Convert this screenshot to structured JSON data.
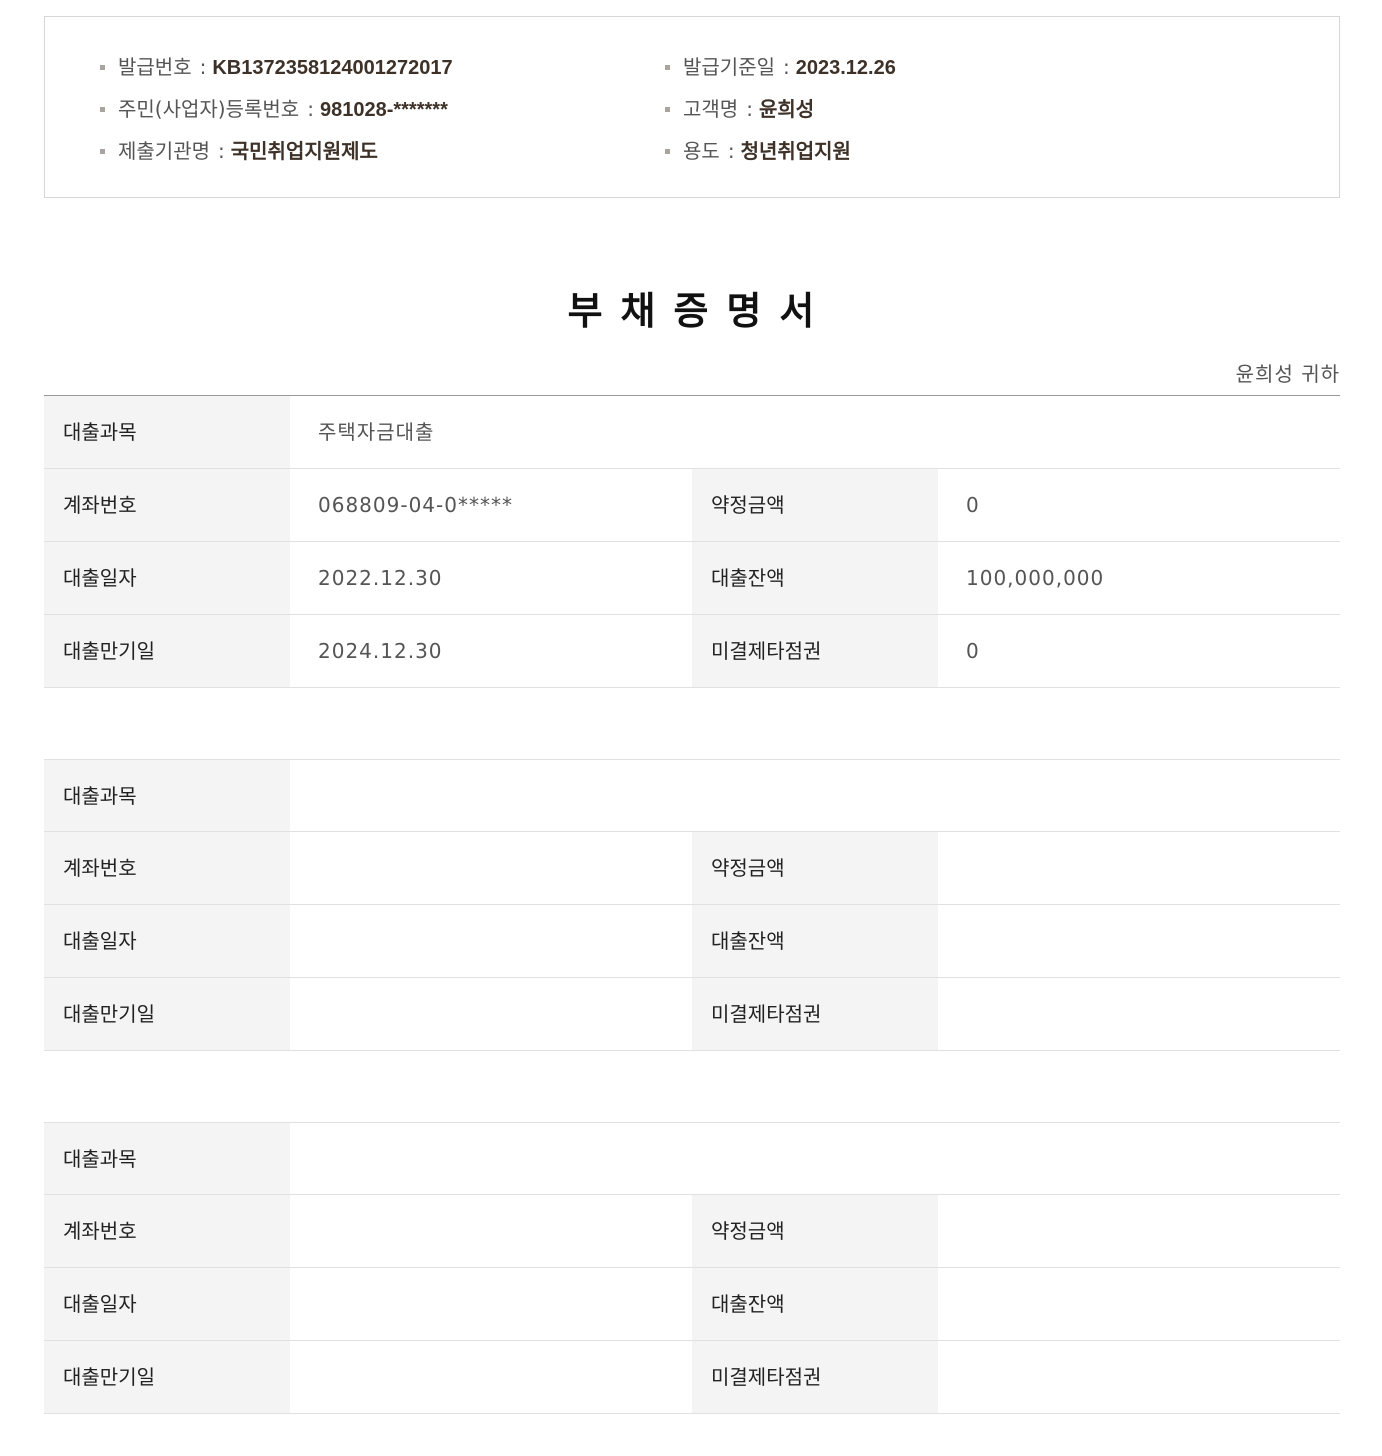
{
  "info": {
    "issue_no": {
      "label": "발급번호",
      "value": "KB137235812400127​2017"
    },
    "issue_date": {
      "label": "발급기준일",
      "value": "2023.12.26"
    },
    "reg_no": {
      "label": "주민(사업자)등록번호",
      "value": "981028-*******"
    },
    "customer": {
      "label": "고객명",
      "value": "윤희성"
    },
    "submit_org": {
      "label": "제출기관명",
      "value": "국민취업지원제도"
    },
    "purpose": {
      "label": "용도",
      "value": "청년취업지원"
    },
    "separator": ":"
  },
  "title": "부채증명서",
  "recipient": "윤희성 귀하",
  "labels": {
    "loan_type": "대출과목",
    "account_no": "계좌번호",
    "agreed_amount": "약정금액",
    "loan_date": "대출일자",
    "loan_balance": "대출잔액",
    "maturity_date": "대출만기일",
    "unsettled_bills": "미결제타점권"
  },
  "loans": [
    {
      "loan_type": "주택자금대출",
      "account_no": "068809-04-0*****",
      "agreed_amount": "0",
      "loan_date": "2022.12.30",
      "loan_balance": "100,000,000",
      "maturity_date": "2024.12.30",
      "unsettled_bills": "0"
    },
    {
      "loan_type": "",
      "account_no": "",
      "agreed_amount": "",
      "loan_date": "",
      "loan_balance": "",
      "maturity_date": "",
      "unsettled_bills": ""
    },
    {
      "loan_type": "",
      "account_no": "",
      "agreed_amount": "",
      "loan_date": "",
      "loan_balance": "",
      "maturity_date": "",
      "unsettled_bills": ""
    }
  ]
}
